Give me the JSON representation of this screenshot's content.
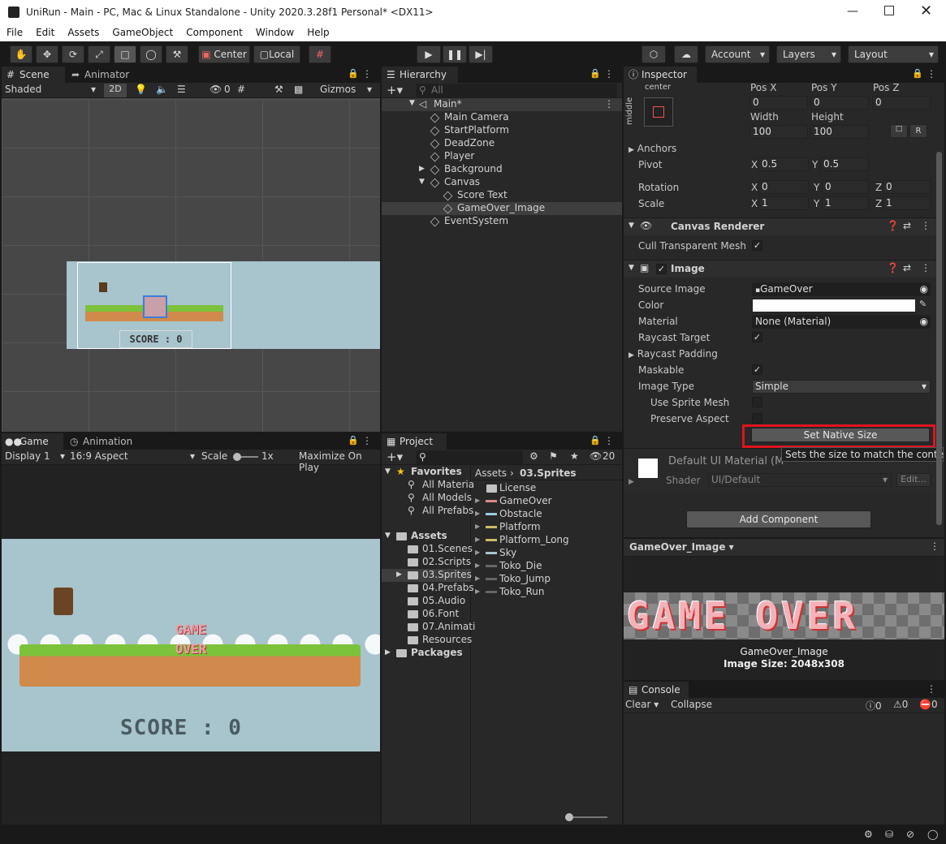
{
  "window": {
    "title": "UniRun - Main - PC, Mac & Linux Standalone - Unity 2020.3.28f1 Personal* <DX11>"
  },
  "menu": [
    "File",
    "Edit",
    "Assets",
    "GameObject",
    "Component",
    "Window",
    "Help"
  ],
  "toolbar": {
    "center": "Center",
    "local": "Local",
    "account": "Account",
    "layers": "Layers",
    "layout": "Layout"
  },
  "scene": {
    "tab": "Scene",
    "tab2": "Animator",
    "shading": "Shaded",
    "mode2d": "2D",
    "hidden_count": "0",
    "gizmos": "Gizmos",
    "score_text": "SCORE : 0"
  },
  "game": {
    "tab": "Game",
    "tab2": "Animation",
    "display": "Display 1",
    "aspect": "16:9 Aspect",
    "scale_label": "Scale",
    "scale_value": "1x",
    "maximize": "Maximize On Play",
    "score_text": "SCORE : 0",
    "overlay_text": "GAME OVER"
  },
  "hierarchy": {
    "tab": "Hierarchy",
    "search_placeholder": "All",
    "scene": "Main*",
    "items": [
      {
        "name": "Main Camera",
        "indent": 1,
        "arrow": ""
      },
      {
        "name": "StartPlatform",
        "indent": 1,
        "arrow": ""
      },
      {
        "name": "DeadZone",
        "indent": 1,
        "arrow": ""
      },
      {
        "name": "Player",
        "indent": 1,
        "arrow": ""
      },
      {
        "name": "Background",
        "indent": 1,
        "arrow": "▶"
      },
      {
        "name": "Canvas",
        "indent": 1,
        "arrow": "▼"
      },
      {
        "name": "Score Text",
        "indent": 2,
        "arrow": ""
      },
      {
        "name": "GameOver_Image",
        "indent": 2,
        "arrow": ""
      },
      {
        "name": "EventSystem",
        "indent": 1,
        "arrow": ""
      }
    ]
  },
  "project": {
    "tab": "Project",
    "count": "20",
    "favorites": "Favorites",
    "fav_items": [
      "All Materia",
      "All Models",
      "All Prefabs"
    ],
    "assets": "Assets",
    "asset_folders": [
      "01.Scenes",
      "02.Scripts",
      "03.Sprites",
      "04.Prefabs",
      "05.Audio",
      "06.Font",
      "07.Animati",
      "Resources"
    ],
    "packages": "Packages",
    "breadcrumb": [
      "Assets",
      "03.Sprites"
    ],
    "files": [
      {
        "name": "License",
        "kind": "folder"
      },
      {
        "name": "GameOver",
        "kind": "sprite"
      },
      {
        "name": "Obstacle",
        "kind": "sprite"
      },
      {
        "name": "Platform",
        "kind": "sprite"
      },
      {
        "name": "Platform_Long",
        "kind": "sprite"
      },
      {
        "name": "Sky",
        "kind": "sprite"
      },
      {
        "name": "Toko_Die",
        "kind": "sprite"
      },
      {
        "name": "Toko_Jump",
        "kind": "sprite"
      },
      {
        "name": "Toko_Run",
        "kind": "sprite"
      }
    ]
  },
  "inspector": {
    "tab": "Inspector",
    "anchor_top": "center",
    "anchor_side": "middle",
    "posx_label": "Pos X",
    "posy_label": "Pos Y",
    "posz_label": "Pos Z",
    "posx": "0",
    "posy": "0",
    "posz": "0",
    "width_label": "Width",
    "height_label": "Height",
    "width": "100",
    "height": "100",
    "r_button": "R",
    "anchors": "Anchors",
    "pivot": "Pivot",
    "pivot_x": "0.5",
    "pivot_y": "0.5",
    "rotation": "Rotation",
    "rot_x": "0",
    "rot_y": "0",
    "rot_z": "0",
    "scale": "Scale",
    "scale_x": "1",
    "scale_y": "1",
    "scale_z": "1",
    "x": "X",
    "y": "Y",
    "z": "Z",
    "canvas_renderer": "Canvas Renderer",
    "cull": "Cull Transparent Mesh",
    "image": "Image",
    "source_image": "Source Image",
    "source_value": "GameOver",
    "color": "Color",
    "color_value": "#ffffff",
    "material": "Material",
    "material_value": "None (Material)",
    "raycast_target": "Raycast Target",
    "raycast_padding": "Raycast Padding",
    "maskable": "Maskable",
    "image_type": "Image Type",
    "image_type_value": "Simple",
    "use_sprite_mesh": "Use Sprite Mesh",
    "preserve_aspect": "Preserve Aspect",
    "set_native": "Set Native Size",
    "tooltip": "Sets the size to match the content.",
    "default_mat": "Default UI Material (M",
    "shader": "Shader",
    "shader_value": "UI/Default",
    "edit": "Edit...",
    "add_component": "Add Component",
    "preview_name": "GameOver_Image",
    "preview_label": "GameOver_Image",
    "image_size": "Image Size: 2048x308",
    "preview_text": "GAME OVER"
  },
  "console": {
    "tab": "Console",
    "clear": "Clear",
    "collapse": "Collapse",
    "logs": "0",
    "warnings": "0",
    "errors": "0"
  },
  "colors": {
    "highlight": "#e0141e",
    "sky": "#a8c4cc",
    "grass": "#7cc23a",
    "dirt": "#d08a4c"
  }
}
